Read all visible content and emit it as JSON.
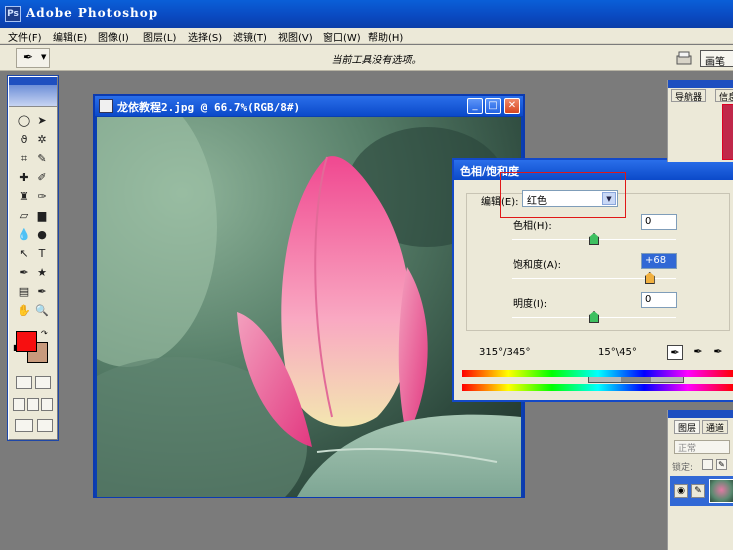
{
  "app": {
    "title": "Adobe Photoshop",
    "logo_text": "Ps"
  },
  "menu": [
    {
      "label": "文件(F)"
    },
    {
      "label": "编辑(E)"
    },
    {
      "label": "图像(I)"
    },
    {
      "label": "图层(L)"
    },
    {
      "label": "选择(S)"
    },
    {
      "label": "滤镜(T)"
    },
    {
      "label": "视图(V)"
    },
    {
      "label": "窗口(W)"
    },
    {
      "label": "帮助(H)"
    }
  ],
  "options_bar": {
    "message": "当前工具没有选项。",
    "brushes_tab": "画笔"
  },
  "document": {
    "title": "龙依教程2.jpg @ 66.7%(RGB/8#)"
  },
  "dialog": {
    "title": "色相/饱和度",
    "edit_label": "编辑(E):",
    "edit_value": "红色",
    "hue_label": "色相(H):",
    "hue_value": "0",
    "saturation_label": "饱和度(A):",
    "saturation_value": "+68",
    "lightness_label": "明度(I):",
    "lightness_value": "0",
    "range_left": "315°/345°",
    "range_right": "15°\\45°"
  },
  "sliders": {
    "hue": 0.5,
    "saturation": 0.84,
    "lightness": 0.5
  },
  "colors": {
    "foreground": "#f70f10",
    "background": "#c89a7c",
    "titlebar": "#0b49c9",
    "highlight": "#e01818"
  },
  "navigator": {
    "tab1": "导航器",
    "tab2": "信息"
  },
  "layers": {
    "tab1": "图层",
    "tab2": "通道",
    "blend_mode": "正常",
    "lock_label": "锁定:"
  }
}
